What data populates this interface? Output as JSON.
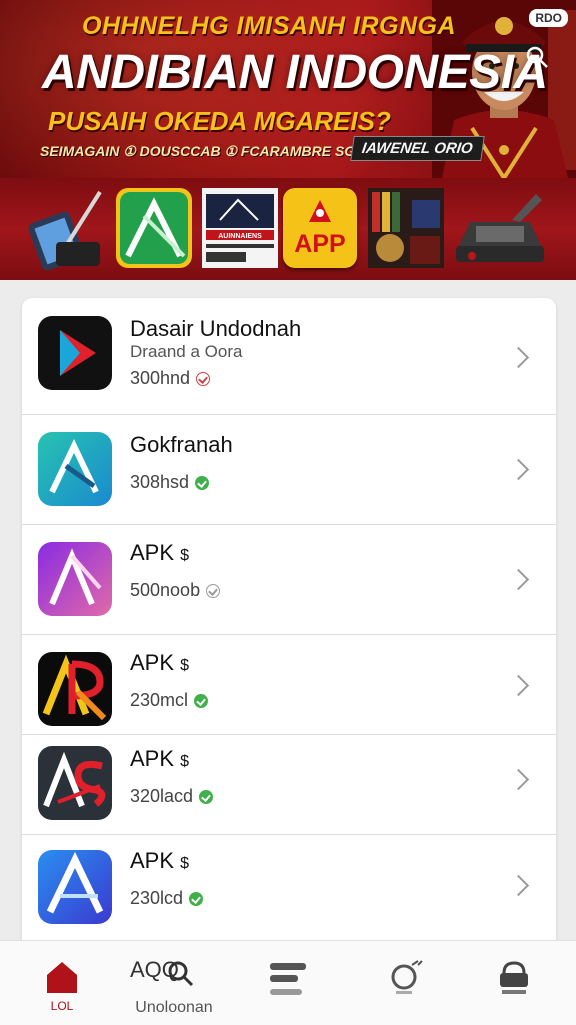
{
  "hero": {
    "line1": "OHHNELHG IMISANH IRGNGA",
    "line2": "ANDIBIAN INDONESIA",
    "line3": "PUSAIH OKEDA MGAREIS?",
    "line4": "SEIMAGAIN ① DOUSCCAB ① FCARAMBRE SGGACAN",
    "badge": "IAWENEL ORIO",
    "corner_tag": "RDO",
    "colors": {
      "background": "#8d0f10",
      "accent": "#f6c21a"
    }
  },
  "strip": {
    "tiles": [
      {
        "icon": "phone-stylus-icon"
      },
      {
        "icon": "green-a-app-icon"
      },
      {
        "icon": "newspaper-icon",
        "text": "AUINNAIENS"
      },
      {
        "icon": "app-button-icon",
        "label": "APP"
      },
      {
        "icon": "book-shelf-icon"
      },
      {
        "icon": "gadget-device-icon"
      }
    ]
  },
  "list": {
    "items": [
      {
        "title": "Dasair Undodnah",
        "subtitle": "Draand a Oora",
        "meta": "300hnd",
        "status": "red-outline",
        "icon": "play-red-icon"
      },
      {
        "title": "Gokfranah",
        "subtitle": "",
        "meta": "308hsd",
        "status": "green",
        "icon": "teal-a-icon"
      },
      {
        "title": "APK",
        "subtitle": "",
        "meta": "500noob",
        "status": "outline",
        "icon": "purple-a-icon",
        "tag": "$"
      },
      {
        "title": "APK",
        "subtitle": "",
        "meta": "230mcl",
        "status": "green",
        "icon": "ap-black-icon",
        "tag": "$"
      },
      {
        "title": "APK",
        "subtitle": "",
        "meta": "320lacd",
        "status": "green",
        "icon": "as-dark-icon",
        "tag": "$"
      },
      {
        "title": "APK",
        "subtitle": "",
        "meta": "230lcd",
        "status": "green",
        "icon": "blue-a-icon",
        "tag": "$"
      }
    ]
  },
  "nav": {
    "items": [
      {
        "label": "LOL",
        "icon": "home-icon",
        "active": true
      },
      {
        "label": "Unoloonan",
        "icon": "search-apps-icon",
        "title": "AQQ"
      },
      {
        "label": "",
        "icon": "menu-lines-icon"
      },
      {
        "label": "",
        "icon": "gamepad-icon"
      },
      {
        "label": "",
        "icon": "profile-lock-icon"
      }
    ]
  }
}
